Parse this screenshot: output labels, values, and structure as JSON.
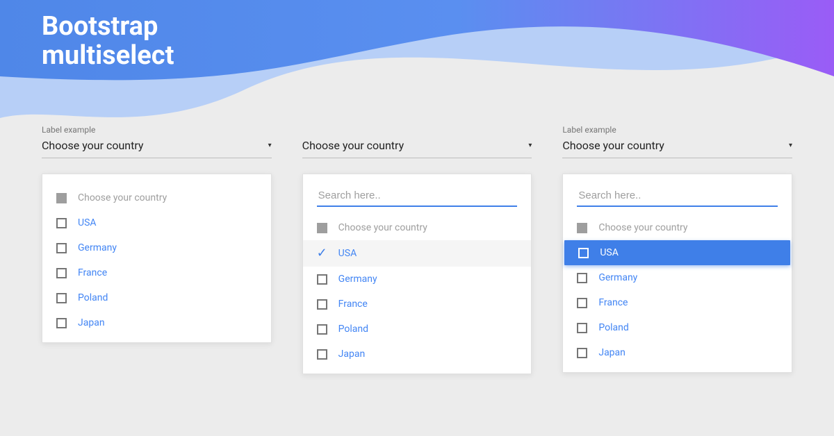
{
  "header": {
    "title_line1": "Bootstrap",
    "title_line2": "multiselect"
  },
  "label_text": "Label example",
  "placeholder": "Choose your country",
  "search_placeholder": "Search here..",
  "caret": "▾",
  "countries": {
    "usa": "USA",
    "germany": "Germany",
    "france": "France",
    "poland": "Poland",
    "japan": "Japan"
  },
  "colors": {
    "blue": "#4f87e8",
    "purple": "#8b5cf6",
    "link": "#4285f4",
    "bg": "#ececec"
  }
}
